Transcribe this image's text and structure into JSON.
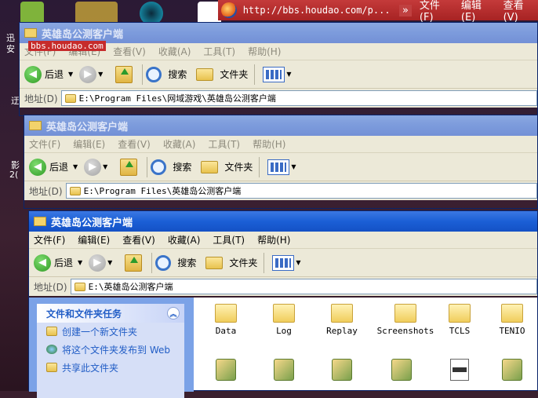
{
  "browser": {
    "url": "http://bbs.houdao.com/p...",
    "more": "»",
    "menu": [
      "文件(F)",
      "编辑(E)",
      "查看(V)"
    ]
  },
  "watermark": "bbs.houdao.com",
  "desktop_text": [
    "迅",
    "安",
    "迂",
    "影",
    "2("
  ],
  "windows": [
    {
      "title": "英雄岛公测客户端",
      "menu": [
        "文件(F)",
        "编辑(E)",
        "查看(V)",
        "收藏(A)",
        "工具(T)",
        "帮助(H)"
      ],
      "back": "后退",
      "search": "搜索",
      "folders": "文件夹",
      "address_label": "地址(D)",
      "address": "E:\\Program Files\\网域游戏\\英雄岛公测客户端"
    },
    {
      "title": "英雄岛公测客户端",
      "menu": [
        "文件(F)",
        "编辑(E)",
        "查看(V)",
        "收藏(A)",
        "工具(T)",
        "帮助(H)"
      ],
      "back": "后退",
      "search": "搜索",
      "folders": "文件夹",
      "address_label": "地址(D)",
      "address": "E:\\Program Files\\英雄岛公测客户端"
    },
    {
      "title": "英雄岛公测客户端",
      "menu": [
        "文件(F)",
        "编辑(E)",
        "查看(V)",
        "收藏(A)",
        "工具(T)",
        "帮助(H)"
      ],
      "back": "后退",
      "search": "搜索",
      "folders": "文件夹",
      "address_label": "地址(D)",
      "address": "E:\\英雄岛公测客户端"
    }
  ],
  "tasks": {
    "title": "文件和文件夹任务",
    "items": [
      "创建一个新文件夹",
      "将这个文件夹发布到 Web",
      "共享此文件夹"
    ]
  },
  "files": [
    "Data",
    "Log",
    "Replay",
    "Screenshots",
    "TCLS",
    "TENIO"
  ]
}
